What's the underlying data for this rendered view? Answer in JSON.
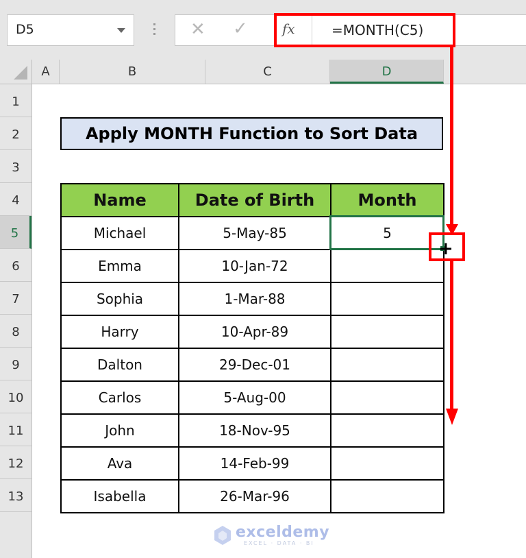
{
  "formula_bar": {
    "name_box": "D5",
    "cancel_icon": "cancel-x-icon",
    "enter_icon": "checkmark-icon",
    "fx_label": "fx",
    "formula": "=MONTH(C5)"
  },
  "columns": [
    "A",
    "B",
    "C",
    "D"
  ],
  "selected_column": "D",
  "rows": [
    "1",
    "2",
    "3",
    "4",
    "5",
    "6",
    "7",
    "8",
    "9",
    "10",
    "11",
    "12",
    "13"
  ],
  "selected_row": "5",
  "sheet": {
    "title": "Apply MONTH Function to Sort Data",
    "headers": [
      "Name",
      "Date of Birth",
      "Month"
    ],
    "records": [
      {
        "name": "Michael",
        "dob": "5-May-85",
        "month": "5"
      },
      {
        "name": "Emma",
        "dob": "10-Jan-72",
        "month": ""
      },
      {
        "name": "Sophia",
        "dob": "1-Mar-88",
        "month": ""
      },
      {
        "name": "Harry",
        "dob": "10-Apr-89",
        "month": ""
      },
      {
        "name": "Dalton",
        "dob": "29-Dec-01",
        "month": ""
      },
      {
        "name": "Carlos",
        "dob": "5-Aug-00",
        "month": ""
      },
      {
        "name": "John",
        "dob": "18-Nov-95",
        "month": ""
      },
      {
        "name": "Ava",
        "dob": "14-Feb-99",
        "month": ""
      },
      {
        "name": "Isabella",
        "dob": "26-Mar-96",
        "month": ""
      }
    ]
  },
  "annotation": {
    "color": "#ff0000",
    "fill_handle_icon": "fill-handle-cross-icon"
  },
  "watermark": {
    "name": "exceldemy",
    "tagline": "EXCEL · DATA · BI"
  }
}
